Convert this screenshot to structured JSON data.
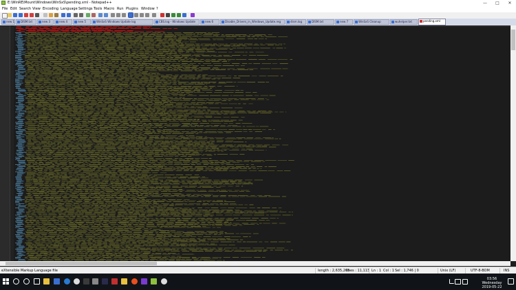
{
  "window": {
    "title": "E:\\WinRE\\Mount\\Windows\\WinSxS\\pending.xml - Notepad++",
    "minimize": "—",
    "maximize": "□",
    "close": "✕"
  },
  "menu": [
    "File",
    "Edit",
    "Search",
    "View",
    "Encoding",
    "Language",
    "Settings",
    "Tools",
    "Macro",
    "Run",
    "Plugins",
    "Window",
    "?"
  ],
  "tabs": [
    {
      "label": "new 1"
    },
    {
      "label": "DISM.txt"
    },
    {
      "label": "new 3"
    },
    {
      "label": "new 4"
    },
    {
      "label": "new 5"
    },
    {
      "label": "WinSxS Windows Update log"
    },
    {
      "label": "CBS.log - Windows Update"
    },
    {
      "label": "new 6"
    },
    {
      "label": "Disable_Drivers_in_Windows_Update.reg"
    },
    {
      "label": "dism.log"
    },
    {
      "label": "DISM.txt"
    },
    {
      "label": "new 7"
    },
    {
      "label": "WinSxS Cleanup"
    },
    {
      "label": "wuhelper.txt"
    },
    {
      "label": "pending.xml",
      "active": true
    }
  ],
  "status": {
    "file_type": "eXtensible Markup Language file",
    "length": "length : 2,635,265",
    "lines": "lines : 11,113",
    "ln": "Ln : 1",
    "col": "Col : 1",
    "sel": "Sel : 1,746 | 0",
    "eol": "Unix (LF)",
    "encoding": "UTF-8-BOM",
    "mode": "INS"
  },
  "clock": {
    "time": "03:56",
    "day": "Wednesday",
    "date": "2019-05-22"
  },
  "colors": {
    "editor_bg": "#1c1c1c",
    "code_text": "#6b6b2a",
    "tag_text": "#4a7a9a",
    "highlight": "#c81414",
    "taskbar": "#101418"
  }
}
